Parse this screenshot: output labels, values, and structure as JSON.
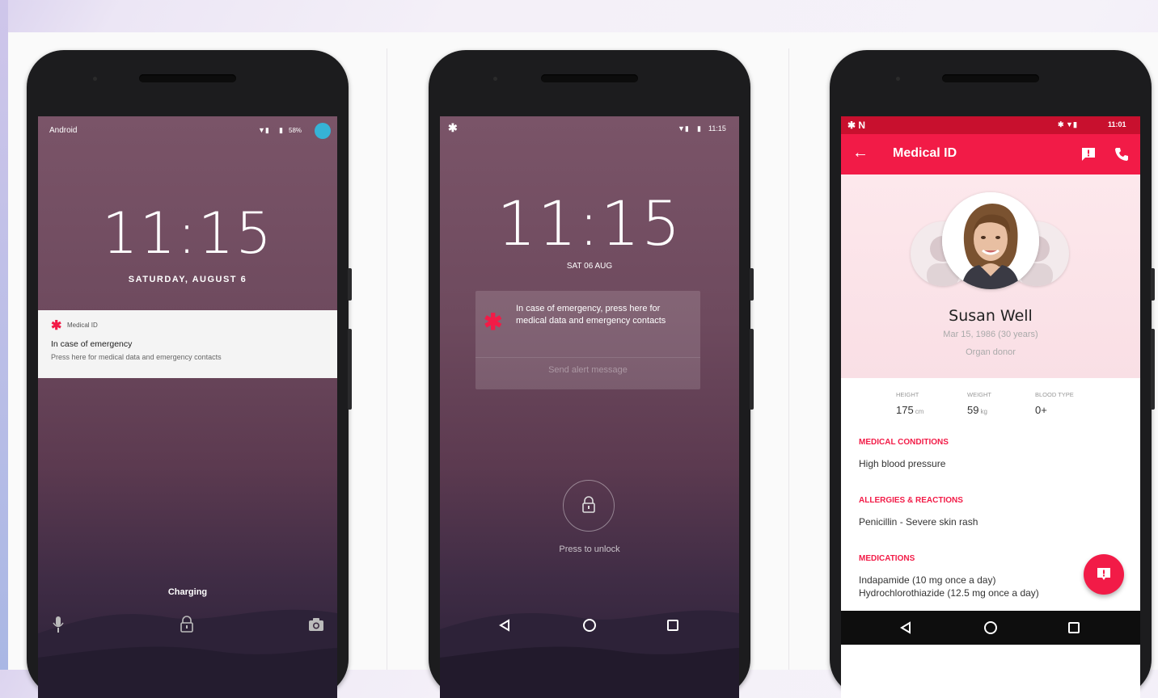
{
  "phone1": {
    "carrier": "Android",
    "battery": "58%",
    "time": "11:15",
    "date": "SATURDAY, AUGUST 6",
    "notification": {
      "app": "Medical ID",
      "title": "In case of emergency",
      "text": "Press here for medical data and emergency contacts"
    },
    "charging": "Charging"
  },
  "phone2": {
    "status_time": "11:15",
    "time": "11:15",
    "date": "SAT 06 AUG",
    "card_message": "In case of emergency, press here for medical data and emergency contacts",
    "alert_button": "Send alert message",
    "unlock_hint": "Press to unlock"
  },
  "phone3": {
    "status_time": "11:01",
    "title": "Medical ID",
    "name": "Susan Well",
    "birth": "Mar 15, 1986 (30 years)",
    "donor": "Organ donor",
    "stats": [
      {
        "label": "HEIGHT",
        "value": "175",
        "unit": "cm"
      },
      {
        "label": "WEIGHT",
        "value": "59",
        "unit": "kg"
      },
      {
        "label": "BLOOD TYPE",
        "value": "0+",
        "unit": ""
      }
    ],
    "sections": [
      {
        "title": "MEDICAL CONDITIONS",
        "lines": [
          "High blood pressure"
        ]
      },
      {
        "title": "ALLERGIES & REACTIONS",
        "lines": [
          "Penicillin - Severe skin rash"
        ]
      },
      {
        "title": "MEDICATIONS",
        "lines": [
          "Indapamide (10 mg once a day)",
          "Hydrochlorothiazide (12.5 mg once a day)"
        ]
      }
    ]
  },
  "colors": {
    "accent": "#f21b47",
    "status_red": "#c8102e",
    "lock_purple": "#6e4a5e"
  }
}
